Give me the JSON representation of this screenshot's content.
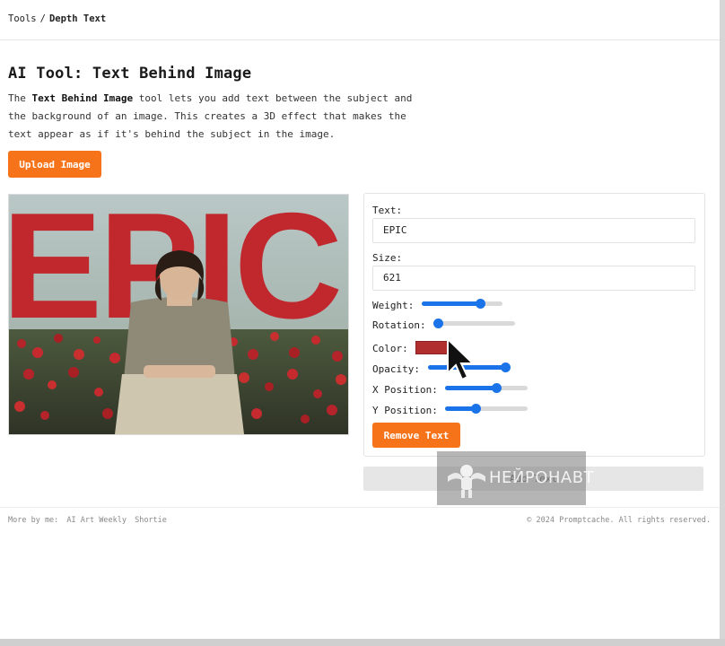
{
  "breadcrumb": {
    "root": "Tools",
    "separator": "/",
    "current": "Depth Text"
  },
  "page": {
    "title": "AI Tool: Text Behind Image",
    "intro_prefix": "The ",
    "intro_bold": "Text Behind Image",
    "intro_rest": " tool lets you add text between the subject and the background of an image. This creates a 3D effect that makes the text appear as if it's behind the subject in the image."
  },
  "upload_button": "Upload Image",
  "preview": {
    "overlay_text": "EPIC",
    "text_color": "#c0282e"
  },
  "controls": {
    "text_label": "Text:",
    "text_value": "EPIC",
    "size_label": "Size:",
    "size_value": "621",
    "weight_label": "Weight:",
    "weight_level": 0.72,
    "rotation_label": "Rotation:",
    "rotation_level": 0.0,
    "color_label": "Color:",
    "color_value": "#b12e2e",
    "opacity_label": "Opacity:",
    "opacity_level": 1.0,
    "x_position_label": "X Position:",
    "x_position_level": 0.62,
    "y_position_label": "Y Position:",
    "y_position_level": 0.37,
    "remove_button": "Remove Text"
  },
  "add_text_button": "Add Text",
  "watermark": {
    "text": "НЕЙРОНАВТ"
  },
  "footer": {
    "more_by_prefix": "More by me:",
    "links": [
      "AI Art Weekly",
      "Shortie"
    ],
    "copyright": "© 2024 Promptcache. All rights reserved."
  },
  "colors": {
    "accent_orange": "#f7731a",
    "slider_blue": "#1a73e8"
  }
}
